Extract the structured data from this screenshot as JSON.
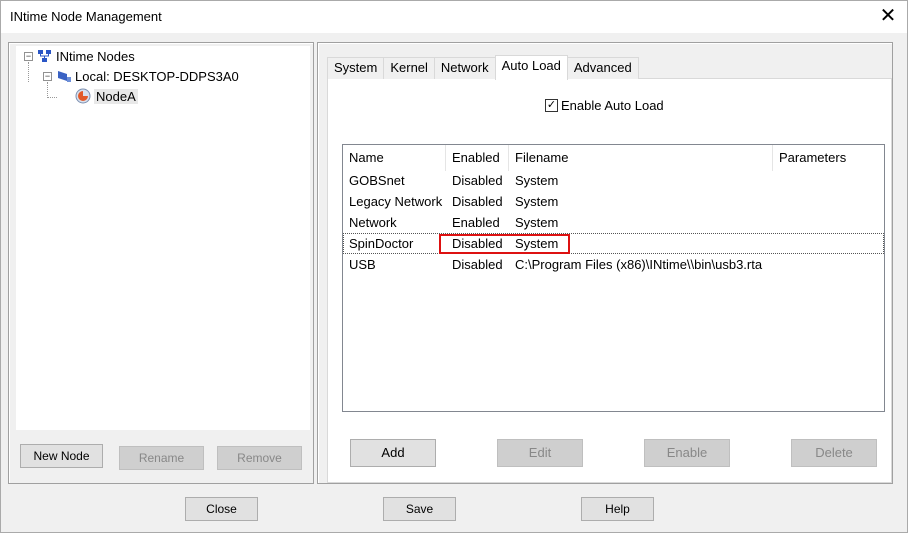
{
  "window": {
    "title": "INtime Node Management"
  },
  "tree": {
    "root": "INtime Nodes",
    "local": "Local: DESKTOP-DDPS3A0",
    "node": "NodeA"
  },
  "left_buttons": {
    "new_node": "New Node",
    "rename": "Rename",
    "remove": "Remove"
  },
  "tabs": [
    "System",
    "Kernel",
    "Network",
    "Auto Load",
    "Advanced"
  ],
  "active_tab": "Auto Load",
  "auto_load": {
    "enable_label": "Enable Auto Load",
    "enable_checked": true,
    "columns": [
      "Name",
      "Enabled",
      "Filename",
      "Parameters"
    ],
    "rows": [
      {
        "name": "GOBSnet",
        "enabled": "Disabled",
        "filename": "System",
        "parameters": ""
      },
      {
        "name": "Legacy Network",
        "enabled": "Disabled",
        "filename": "System",
        "parameters": ""
      },
      {
        "name": "Network",
        "enabled": "Enabled",
        "filename": "System",
        "parameters": ""
      },
      {
        "name": "SpinDoctor",
        "enabled": "Disabled",
        "filename": "System",
        "parameters": ""
      },
      {
        "name": "USB",
        "enabled": "Disabled",
        "filename": "C:\\Program Files (x86)\\INtime\\\\bin\\usb3.rta",
        "parameters": ""
      }
    ],
    "buttons": {
      "add": "Add",
      "edit": "Edit",
      "enable": "Enable",
      "delete": "Delete"
    }
  },
  "bottom_buttons": {
    "close": "Close",
    "save": "Save",
    "help": "Help"
  },
  "colors": {
    "highlight": "#dd1111",
    "window_bg": "#f0f0f0"
  }
}
